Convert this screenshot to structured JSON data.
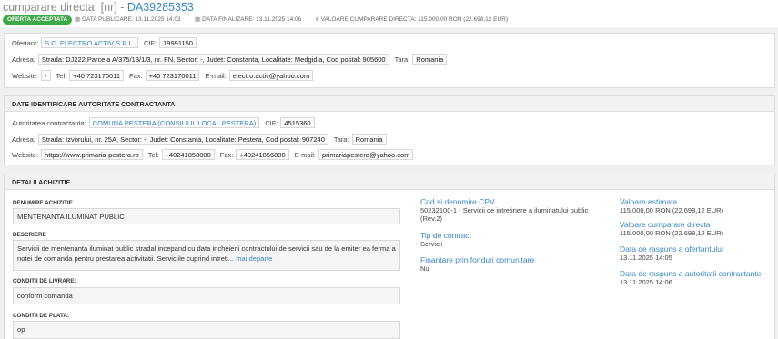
{
  "header": {
    "title_prefix": "cumparare directa: [nr] - ",
    "code": "DA39285353",
    "badge": "OFERTA ACCEPTATA",
    "pub_label": "DATA PUBLICARE: 13.11.2025 14:03",
    "fin_label": "DATA FINALIZARE: 13.11.2025 14:06",
    "value_label": "VALOARE CUMPARARE DIRECTA: 115.000,00  RON (22.698,12  EUR)"
  },
  "ofertant": {
    "name_label": "Ofertant:",
    "name": "S.C. ELECTRO ACTIV S.R.L.",
    "cif_label": "CIF:",
    "cif": "19991150",
    "adresa_label": "Adresa:",
    "adresa": "Strada: DJ222,Parcela A/375/13/1/3, nr. FN, Sector: -, Judet: Constanta, Localitate: Medgidia, Cod postal: 905600",
    "tara_label": "Tara:",
    "tara": "Romania",
    "website_label": "Website:",
    "website": "-",
    "tel_label": "Tel:",
    "tel": "+40 723170011",
    "fax_label": "Fax:",
    "fax": "+40 723170011",
    "email_label": "E-mail:",
    "email": "electro.activ@yahoo.com"
  },
  "autoritate": {
    "heading": "DATE IDENTIFICARE AUTORITATE CONTRACTANTA",
    "name_label": "Autoritatea contractanta:",
    "name": "COMUNA PESTERA (CONSILIUL LOCAL PESTERA)",
    "cif_label": "CIF:",
    "cif": "4515360",
    "adresa_label": "Adresa:",
    "adresa": "Strada: Izvorului, nr. 25A, Sector: -, Judet: Constanta, Localitate: Pestera, Cod postal: 907240",
    "tara_label": "Tara:",
    "tara": "Romania",
    "website_label": "Website:",
    "website": "https://www.primaria-pestera.ro",
    "tel_label": "Tel:",
    "tel": "+40241858000",
    "fax_label": "Fax:",
    "fax": "+40241856800",
    "email_label": "E-mail:",
    "email": "primariapestera@yahoo.com"
  },
  "detalii": {
    "heading": "DETALII ACHIZITIE",
    "denumire_label": "DENUMIRE ACHIZITIE",
    "denumire": "MENTENANTA ILUMINAT PUBLIC",
    "descriere_label": "DESCRIERE",
    "descriere": "Servicii de mentenanta iluminat public stradal incepand cu data incheierii contractului de servicii sau de la emiter ea ferma a notei de comanda pentru prestarea activitatii. Serviciile cuprind intreti...",
    "mai_departe": "mai departe",
    "livrare_label": "CONDITII DE LIVRARE:",
    "livrare": "conform comanda",
    "plata_label": "CONDITII DE PLATA:",
    "plata": "op",
    "cpv_label": "Cod si denumire CPV",
    "cpv": "50232100-1 - Servicii de intretinere a iluminatului public (Rev.2)",
    "tip_label": "Tip de contract",
    "tip": "Servicii",
    "fonduri_label": "Finantare prin fonduri comunitare",
    "fonduri": "Nu",
    "estimata_label": "Valoare estimata",
    "estimata": "115.000,00  RON (22.698,12  EUR)",
    "cumparare_label": "Valoare cumparare directa",
    "cumparare": "115.000,00  RON (22.698,12  EUR)",
    "raspuns_of_label": "Data de raspuns a ofertantului",
    "raspuns_of": "13.11.2025 14:05",
    "raspuns_ac_label": "Data de raspuns a autoritatii contractante",
    "raspuns_ac": "13.11.2025 14:06"
  }
}
